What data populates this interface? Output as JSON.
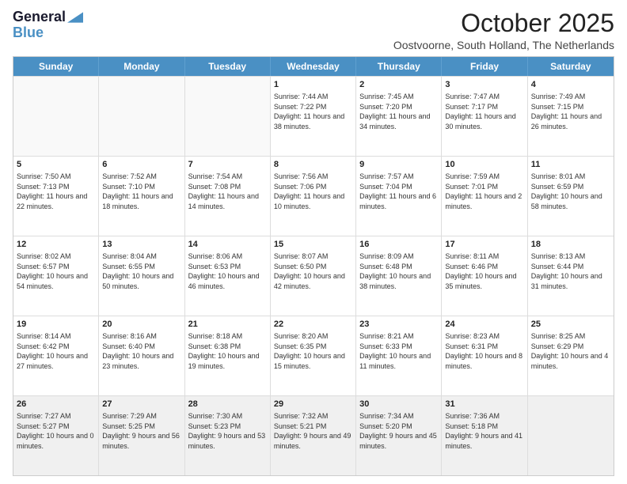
{
  "logo": {
    "general": "General",
    "blue": "Blue"
  },
  "header": {
    "month": "October 2025",
    "location": "Oostvoorne, South Holland, The Netherlands"
  },
  "days": [
    "Sunday",
    "Monday",
    "Tuesday",
    "Wednesday",
    "Thursday",
    "Friday",
    "Saturday"
  ],
  "weeks": [
    [
      {
        "day": "",
        "content": ""
      },
      {
        "day": "",
        "content": ""
      },
      {
        "day": "",
        "content": ""
      },
      {
        "day": "1",
        "content": "Sunrise: 7:44 AM\nSunset: 7:22 PM\nDaylight: 11 hours\nand 38 minutes."
      },
      {
        "day": "2",
        "content": "Sunrise: 7:45 AM\nSunset: 7:20 PM\nDaylight: 11 hours\nand 34 minutes."
      },
      {
        "day": "3",
        "content": "Sunrise: 7:47 AM\nSunset: 7:17 PM\nDaylight: 11 hours\nand 30 minutes."
      },
      {
        "day": "4",
        "content": "Sunrise: 7:49 AM\nSunset: 7:15 PM\nDaylight: 11 hours\nand 26 minutes."
      }
    ],
    [
      {
        "day": "5",
        "content": "Sunrise: 7:50 AM\nSunset: 7:13 PM\nDaylight: 11 hours\nand 22 minutes."
      },
      {
        "day": "6",
        "content": "Sunrise: 7:52 AM\nSunset: 7:10 PM\nDaylight: 11 hours\nand 18 minutes."
      },
      {
        "day": "7",
        "content": "Sunrise: 7:54 AM\nSunset: 7:08 PM\nDaylight: 11 hours\nand 14 minutes."
      },
      {
        "day": "8",
        "content": "Sunrise: 7:56 AM\nSunset: 7:06 PM\nDaylight: 11 hours\nand 10 minutes."
      },
      {
        "day": "9",
        "content": "Sunrise: 7:57 AM\nSunset: 7:04 PM\nDaylight: 11 hours\nand 6 minutes."
      },
      {
        "day": "10",
        "content": "Sunrise: 7:59 AM\nSunset: 7:01 PM\nDaylight: 11 hours\nand 2 minutes."
      },
      {
        "day": "11",
        "content": "Sunrise: 8:01 AM\nSunset: 6:59 PM\nDaylight: 10 hours\nand 58 minutes."
      }
    ],
    [
      {
        "day": "12",
        "content": "Sunrise: 8:02 AM\nSunset: 6:57 PM\nDaylight: 10 hours\nand 54 minutes."
      },
      {
        "day": "13",
        "content": "Sunrise: 8:04 AM\nSunset: 6:55 PM\nDaylight: 10 hours\nand 50 minutes."
      },
      {
        "day": "14",
        "content": "Sunrise: 8:06 AM\nSunset: 6:53 PM\nDaylight: 10 hours\nand 46 minutes."
      },
      {
        "day": "15",
        "content": "Sunrise: 8:07 AM\nSunset: 6:50 PM\nDaylight: 10 hours\nand 42 minutes."
      },
      {
        "day": "16",
        "content": "Sunrise: 8:09 AM\nSunset: 6:48 PM\nDaylight: 10 hours\nand 38 minutes."
      },
      {
        "day": "17",
        "content": "Sunrise: 8:11 AM\nSunset: 6:46 PM\nDaylight: 10 hours\nand 35 minutes."
      },
      {
        "day": "18",
        "content": "Sunrise: 8:13 AM\nSunset: 6:44 PM\nDaylight: 10 hours\nand 31 minutes."
      }
    ],
    [
      {
        "day": "19",
        "content": "Sunrise: 8:14 AM\nSunset: 6:42 PM\nDaylight: 10 hours\nand 27 minutes."
      },
      {
        "day": "20",
        "content": "Sunrise: 8:16 AM\nSunset: 6:40 PM\nDaylight: 10 hours\nand 23 minutes."
      },
      {
        "day": "21",
        "content": "Sunrise: 8:18 AM\nSunset: 6:38 PM\nDaylight: 10 hours\nand 19 minutes."
      },
      {
        "day": "22",
        "content": "Sunrise: 8:20 AM\nSunset: 6:35 PM\nDaylight: 10 hours\nand 15 minutes."
      },
      {
        "day": "23",
        "content": "Sunrise: 8:21 AM\nSunset: 6:33 PM\nDaylight: 10 hours\nand 11 minutes."
      },
      {
        "day": "24",
        "content": "Sunrise: 8:23 AM\nSunset: 6:31 PM\nDaylight: 10 hours\nand 8 minutes."
      },
      {
        "day": "25",
        "content": "Sunrise: 8:25 AM\nSunset: 6:29 PM\nDaylight: 10 hours\nand 4 minutes."
      }
    ],
    [
      {
        "day": "26",
        "content": "Sunrise: 7:27 AM\nSunset: 5:27 PM\nDaylight: 10 hours\nand 0 minutes."
      },
      {
        "day": "27",
        "content": "Sunrise: 7:29 AM\nSunset: 5:25 PM\nDaylight: 9 hours\nand 56 minutes."
      },
      {
        "day": "28",
        "content": "Sunrise: 7:30 AM\nSunset: 5:23 PM\nDaylight: 9 hours\nand 53 minutes."
      },
      {
        "day": "29",
        "content": "Sunrise: 7:32 AM\nSunset: 5:21 PM\nDaylight: 9 hours\nand 49 minutes."
      },
      {
        "day": "30",
        "content": "Sunrise: 7:34 AM\nSunset: 5:20 PM\nDaylight: 9 hours\nand 45 minutes."
      },
      {
        "day": "31",
        "content": "Sunrise: 7:36 AM\nSunset: 5:18 PM\nDaylight: 9 hours\nand 41 minutes."
      },
      {
        "day": "",
        "content": ""
      }
    ]
  ]
}
